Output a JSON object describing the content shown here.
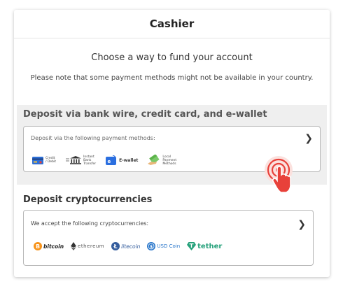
{
  "header": {
    "title": "Cashier"
  },
  "intro": {
    "subtitle": "Choose a way to fund your account",
    "note": "Please note that some payment methods might not be available in your country."
  },
  "bank": {
    "title": "Deposit via bank wire, credit card, and e-wallet",
    "box_label": "Deposit via the following payment methods:",
    "methods": [
      {
        "icon": "credit-card-icon",
        "label_line1": "Credit",
        "label_line2": "/ Debit"
      },
      {
        "icon": "bank-icon",
        "label_line1": "Instant",
        "label_line2": "Bank",
        "label_line3": "Transfer"
      },
      {
        "icon": "ewallet-icon",
        "label": "E-wallet"
      },
      {
        "icon": "cash-icon",
        "label_line1": "Local",
        "label_line2": "Payment",
        "label_line3": "Methods"
      }
    ]
  },
  "crypto": {
    "title": "Deposit cryptocurrencies",
    "box_label": "We accept the following cryptocurrencies:",
    "coins": [
      {
        "icon": "bitcoin-icon",
        "name": "bitcoin",
        "color": "#f7931a"
      },
      {
        "icon": "ethereum-icon",
        "name": "ethereum",
        "color": "#333333"
      },
      {
        "icon": "litecoin-icon",
        "name": "litecoin",
        "color": "#345d9d"
      },
      {
        "icon": "usdcoin-icon",
        "name": "USD Coin",
        "color": "#2775ca"
      },
      {
        "icon": "tether-icon",
        "name": "tether",
        "color": "#26a17b"
      }
    ]
  },
  "colors": {
    "accent_red": "#e8413a",
    "section_bg": "#efefef"
  }
}
